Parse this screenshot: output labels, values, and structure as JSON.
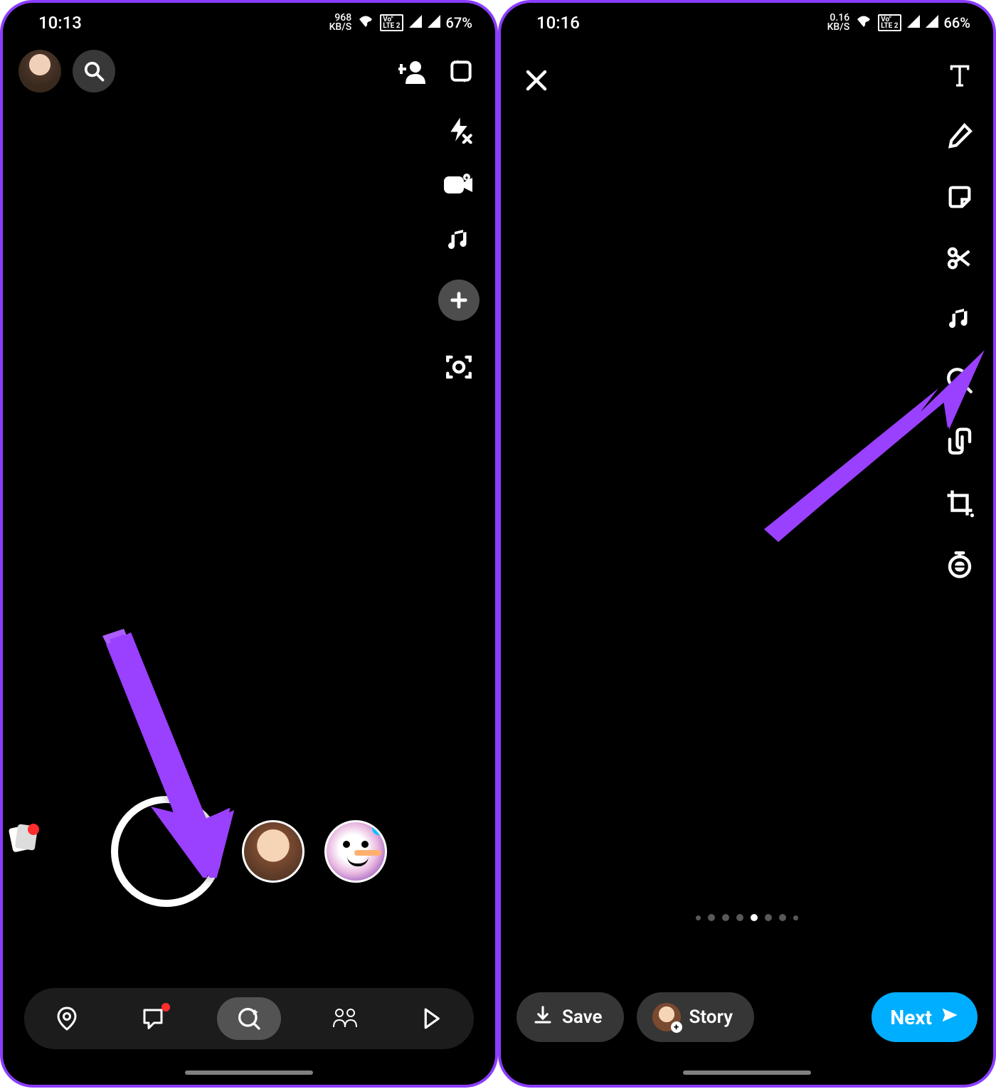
{
  "screen1": {
    "status": {
      "time": "10:13",
      "speed_top": "968",
      "speed_unit": "KB/S",
      "network_badge_top": "Vo\"",
      "network_badge_bot": "LTE 2",
      "battery": "67%"
    }
  },
  "screen2": {
    "status": {
      "time": "10:16",
      "speed_top": "0.16",
      "speed_unit": "KB/S",
      "network_badge_top": "Vo\"",
      "network_badge_bot": "LTE 2",
      "battery": "66%"
    },
    "save_label": "Save",
    "story_label": "Story",
    "next_label": "Next"
  }
}
